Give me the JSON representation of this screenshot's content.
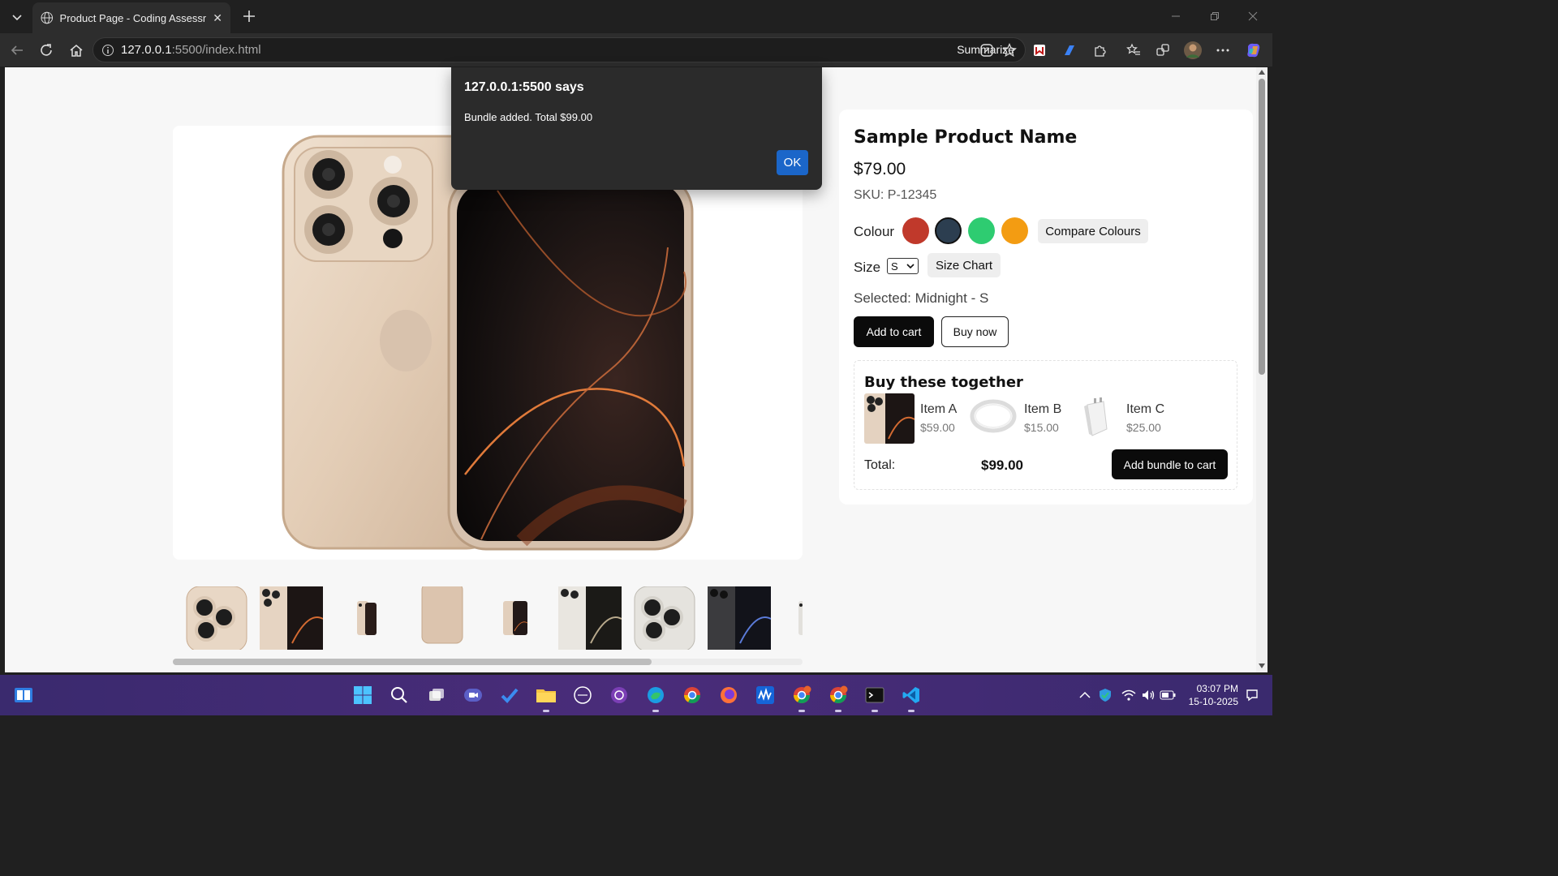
{
  "browser": {
    "tab_title": "Product Page - Coding Assessment",
    "url_host": "127.0.0.1",
    "url_rest": ":5500/index.html",
    "summarize_label": "Summarize"
  },
  "product": {
    "name": "Sample Product Name",
    "price": "$79.00",
    "sku": "SKU: P-12345",
    "colour_label": "Colour",
    "colours": [
      "#c0392b",
      "#2c3e50",
      "#2ecc71",
      "#f39c12"
    ],
    "compare_label": "Compare Colours",
    "size_label": "Size",
    "size_value": "S",
    "size_chart_label": "Size Chart",
    "selected_text": "Selected: Midnight - S",
    "add_to_cart": "Add to cart",
    "buy_now": "Buy now"
  },
  "bundle": {
    "title": "Buy these together",
    "items": [
      {
        "name": "Item A",
        "price": "$59.00"
      },
      {
        "name": "Item B",
        "price": "$15.00"
      },
      {
        "name": "Item C",
        "price": "$25.00"
      }
    ],
    "total_label": "Total:",
    "total_value": "$99.00",
    "add_bundle": "Add bundle to cart"
  },
  "alert": {
    "title": "127.0.0.1:5500 says",
    "message": "Bundle added. Total $99.00",
    "ok_label": "OK"
  },
  "system": {
    "time": "03:07 PM",
    "date": "15-10-2025"
  }
}
